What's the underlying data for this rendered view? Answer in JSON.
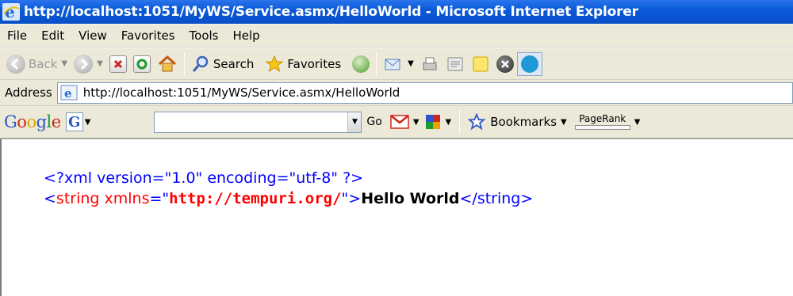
{
  "window": {
    "title": "http://localhost:1051/MyWS/Service.asmx/HelloWorld - Microsoft Internet Explorer"
  },
  "menubar": {
    "items": [
      "File",
      "Edit",
      "View",
      "Favorites",
      "Tools",
      "Help"
    ]
  },
  "toolbar": {
    "back_label": "Back",
    "search_label": "Search",
    "favorites_label": "Favorites"
  },
  "address": {
    "label": "Address",
    "url": "http://localhost:1051/MyWS/Service.asmx/HelloWorld"
  },
  "google_toolbar": {
    "logo": [
      "G",
      "o",
      "o",
      "g",
      "l",
      "e"
    ],
    "g_button": "G",
    "search_value": "",
    "go_label": "Go",
    "bookmarks_label": "Bookmarks",
    "pagerank_label": "PageRank"
  },
  "content": {
    "xml_declaration": "<?xml version=\"1.0\" encoding=\"utf-8\" ?>",
    "open_tag_start": "<",
    "tag_name": "string",
    "attr_name": "xmlns",
    "attr_eq": "=\"",
    "attr_value": "http://tempuri.org/",
    "attr_close": "\">",
    "text": "Hello World",
    "close_tag": "</string>"
  },
  "colors": {
    "titlebar": "#0a5ad8",
    "toolbar_bg": "#ece9d8",
    "xml_markup": "#0000ff",
    "xml_name": "#ff0000"
  }
}
